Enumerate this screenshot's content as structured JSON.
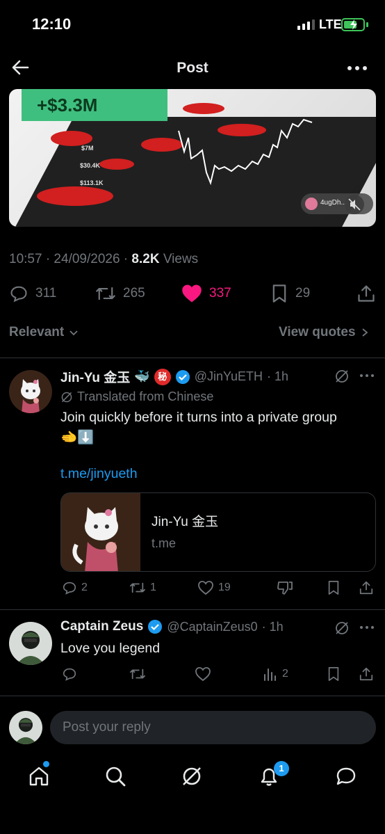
{
  "status_bar": {
    "time": "12:10",
    "network": "LTE"
  },
  "header": {
    "title": "Post"
  },
  "media": {
    "overlay_value": "+$3.3M",
    "labels": [
      "$7M",
      "$30.4K",
      "$113.1K"
    ],
    "badge_text": "4ugDh..."
  },
  "post_meta": {
    "time": "10:57 · 24/09/2026 · ",
    "views_count": "8.2K",
    "views_label": " Views"
  },
  "post_actions": {
    "replies": "311",
    "reposts": "265",
    "likes": "337",
    "bookmarks": "29"
  },
  "filter": {
    "relevant_label": "Relevant",
    "view_quotes_label": "View quotes"
  },
  "replies": [
    {
      "name": "Jin-Yu 金玉",
      "handle": "@JinYuETH",
      "time": "· 1h",
      "translated_label": "Translated from Chinese",
      "text": "Join quickly before it turns into a private group",
      "emoji": "🫲⬇️",
      "link": "t.me/jinyueth",
      "card": {
        "title": "Jin-Yu 金玉",
        "domain": "t.me"
      },
      "stats": {
        "replies": "2",
        "reposts": "1",
        "likes": "19"
      }
    },
    {
      "name": "Captain Zeus",
      "handle": "@CaptainZeus0",
      "time": "· 1h",
      "text": "Love you legend",
      "stats": {
        "views": "2"
      }
    }
  ],
  "reply_bar": {
    "placeholder": "Post your reply"
  },
  "tabbar": {
    "notifications_count": "1"
  },
  "colors": {
    "accent": "#1d9bf0",
    "like": "#f91880",
    "background": "#000000",
    "muted": "#71767b"
  }
}
